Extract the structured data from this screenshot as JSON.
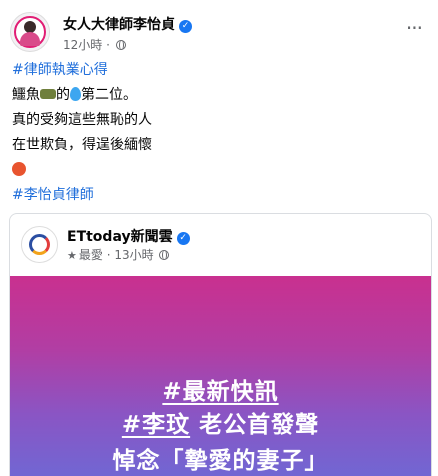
{
  "post": {
    "page_name": "女人大律師李怡貞",
    "verified_mark": "✓",
    "timestamp": "12小時",
    "separator": "·",
    "more_label": "···",
    "hashtag_top": "#律師執業心得",
    "line1_a": "鱷魚",
    "line1_b": "的",
    "line1_c": "第二位。",
    "line2": "真的受夠這些無恥的人",
    "line3": "在世欺負，得逞後緬懷",
    "hashtag_bottom": "#李怡貞律師"
  },
  "shared": {
    "page_name": "ETtoday新聞雲",
    "verified_mark": "✓",
    "star": "★",
    "label": "最愛",
    "separator": "·",
    "timestamp": "13小時",
    "banner": {
      "tag1": "#最新快訊",
      "tag2": "#李玟",
      "line2_rest": " 老公首發聲",
      "line3": "悼念「摯愛的妻子」"
    }
  },
  "icons": [
    "globe-icon",
    "verified-icon",
    "more-icon",
    "crocodile-emoji",
    "droplet-emoji",
    "angry-face-emoji",
    "star-icon"
  ],
  "colors": {
    "hashtag": "#216fdb",
    "verified": "#1877f2",
    "meta": "#65676b",
    "banner_top": "#c9308f",
    "banner_bottom": "#6c6ad6"
  }
}
